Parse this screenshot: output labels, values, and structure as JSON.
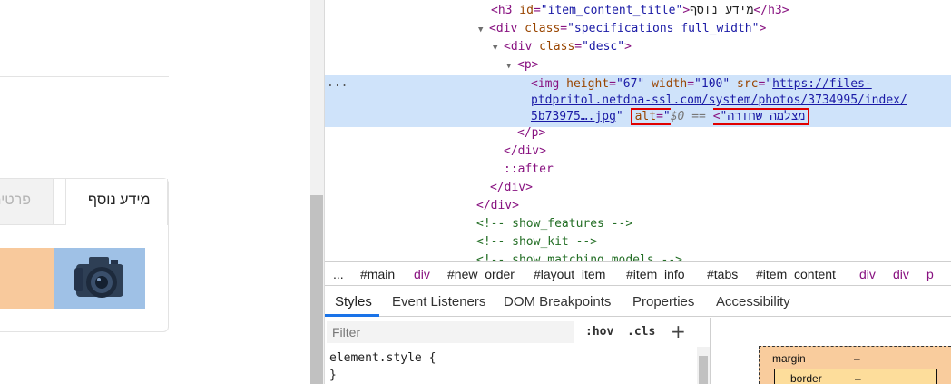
{
  "page": {
    "tab_active_label": "מידע נוסף",
    "tab_inactive_label": "פרטים",
    "image_icon": "camera-icon"
  },
  "elements_tree": {
    "ellipsis": "...",
    "h3": {
      "open": "<h3",
      "attr_name": " id",
      "attr_eq": "=",
      "attr_value": "\"item_content_title\"",
      "close_bracket": ">",
      "text": "מידע נוסף",
      "close_tag": "</h3>"
    },
    "div_spec": {
      "open": "<div",
      "attr_name": " class",
      "attr_eq": "=",
      "attr_value": "\"specifications full_width\"",
      "close_bracket": ">"
    },
    "div_desc": {
      "open": "<div",
      "attr_name": " class",
      "attr_eq": "=",
      "attr_value": "\"desc\"",
      "close_bracket": ">"
    },
    "p_open": "<p>",
    "img": {
      "open": "<img",
      "height_name": " height",
      "height_value": "\"67\"",
      "width_name": " width",
      "width_value": "\"100\"",
      "src_name": " src",
      "src_quote_open": "\"",
      "src_line1": "https://files-",
      "src_line2": "ptdpritol.netdna-ssl.com/system/photos/3734995/index/",
      "src_line3": "5b73975….jpg",
      "src_quote_close": "\"",
      "alt_name": "alt",
      "alt_value": "\"מצלמה שחורה\"",
      "close_bracket": ">",
      "eq_marker": "== $0"
    },
    "p_close": "</p>",
    "div_close_1": "</div>",
    "after_pseudo": "::after",
    "div_close_2": "</div>",
    "div_close_3": "</div>",
    "comment_features": "<!-- show_features -->",
    "comment_kit": "<!-- show_kit -->",
    "comment_matching": "<!-- show_matching_models -->"
  },
  "breadcrumbs": [
    "...",
    "#main",
    "div",
    "#new_order",
    "#layout_item",
    "#item_info",
    "#tabs",
    "#item_content",
    "div",
    "div",
    "p"
  ],
  "subtabs": [
    "Styles",
    "Event Listeners",
    "DOM Breakpoints",
    "Properties",
    "Accessibility"
  ],
  "filter": {
    "placeholder": "Filter",
    "hov": ":hov",
    "cls": ".cls",
    "plus": "+"
  },
  "styles": {
    "rule_selector": "element.style {",
    "rule_close": "}"
  },
  "box_model": {
    "margin_label": "margin",
    "margin_value": "–",
    "border_label": "border",
    "border_value": "–"
  },
  "colors": {
    "selection_bg": "#cfe3fa",
    "highlight_red": "#e00000",
    "tag_purple": "#881280",
    "attr_brown": "#994500",
    "value_blue": "#1a1aa6",
    "comment_green": "#236e25",
    "active_tab_blue": "#1a73e8",
    "margin_peach": "#f9cc9d",
    "image_overlay_blue": "#9fc1e6",
    "page_peach": "#f8c99c"
  }
}
